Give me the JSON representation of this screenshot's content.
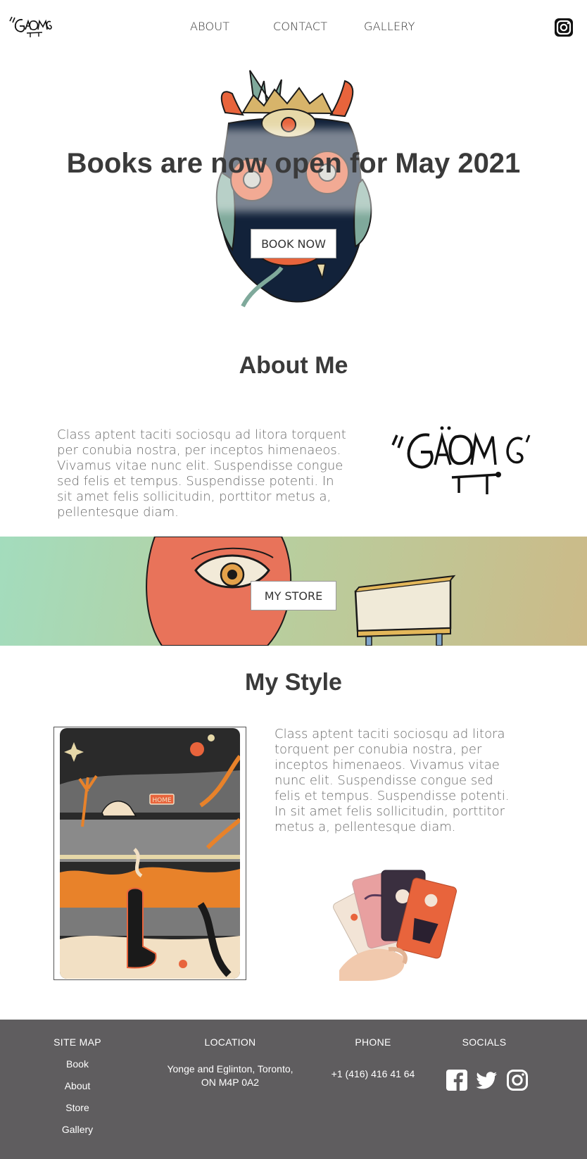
{
  "nav": {
    "logo_alt": "Ghome",
    "links": [
      "ABOUT",
      "CONTACT",
      "GALLERY"
    ],
    "social_icon": "instagram-icon"
  },
  "hero": {
    "title": "Books are now open for May 2021",
    "button_label": "BOOK NOW"
  },
  "about": {
    "title": "About Me",
    "text": "Class aptent taciti sociosqu ad litora torquent per conubia nostra, per inceptos himenaeos. Vivamus vitae nunc elit. Suspendisse congue sed felis et tempus. Suspendisse potenti. In sit amet felis sollicitudin, porttitor metus a, pellentesque diam.",
    "logo_alt": "Ghome"
  },
  "store": {
    "button_label": "MY STORE"
  },
  "style": {
    "title": "My Style",
    "text": "Class aptent taciti sociosqu ad litora torquent per conubia nostra, per inceptos himenaeos. Vivamus vitae nunc elit. Suspendisse congue sed felis et tempus. Suspendisse potenti. In sit amet felis sollicitudin, porttitor metus a, pellentesque diam.",
    "poster_sign": "HOME"
  },
  "footer": {
    "sitemap_heading": "SITE MAP",
    "sitemap_links": [
      "Book",
      "About",
      "Store",
      "Gallery"
    ],
    "location_heading": "LOCATION",
    "location_line1": "Yonge and Eglinton, Toronto,",
    "location_line2": "ON M4P 0A2",
    "phone_heading": "PHONE",
    "phone": "+1 (416) 416 41 64",
    "socials_heading": "SOCIALS",
    "social_icons": [
      "facebook-icon",
      "twitter-icon",
      "instagram-icon"
    ]
  },
  "colors": {
    "footer_bg": "#5f5d5f",
    "text_dark": "#3a3a3a",
    "text_body": "#6a6a6a",
    "accent_orange": "#e8643c"
  }
}
